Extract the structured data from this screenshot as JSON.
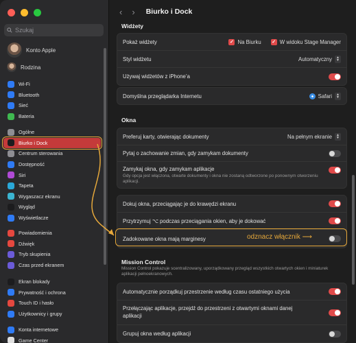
{
  "window": {
    "title": "Biurko i Dock"
  },
  "sidebar": {
    "search_placeholder": "Szukaj",
    "account_name": "Konto Apple",
    "family_label": "Rodzina",
    "groups": [
      [
        {
          "label": "Wi-Fi",
          "icon": "wifi-icon",
          "color": "#2f7bf5"
        },
        {
          "label": "Bluetooth",
          "icon": "bluetooth-icon",
          "color": "#2f7bf5"
        },
        {
          "label": "Sieć",
          "icon": "globe-icon",
          "color": "#2f7bf5"
        },
        {
          "label": "Bateria",
          "icon": "battery-icon",
          "color": "#3fb950"
        }
      ],
      [
        {
          "label": "Ogólne",
          "icon": "gear-icon",
          "color": "#8e8e93"
        },
        {
          "label": "Biurko i Dock",
          "icon": "dock-icon",
          "color": "#1c1c1e",
          "selected": true
        },
        {
          "label": "Centrum sterowania",
          "icon": "control-center-icon",
          "color": "#8e8e93"
        },
        {
          "label": "Dostępność",
          "icon": "accessibility-icon",
          "color": "#2f7bf5"
        },
        {
          "label": "Siri",
          "icon": "siri-icon",
          "color": "#b04ad6"
        },
        {
          "label": "Tapeta",
          "icon": "wallpaper-icon",
          "color": "#2aa8d8"
        },
        {
          "label": "Wygaszacz ekranu",
          "icon": "screensaver-icon",
          "color": "#3bb4d0"
        },
        {
          "label": "Wygląd",
          "icon": "appearance-icon",
          "color": "#1c1c1e"
        },
        {
          "label": "Wyświetlacze",
          "icon": "display-icon",
          "color": "#2f7bf5"
        }
      ],
      [
        {
          "label": "Powiadomienia",
          "icon": "notifications-icon",
          "color": "#e5483f"
        },
        {
          "label": "Dźwięk",
          "icon": "sound-icon",
          "color": "#e5483f"
        },
        {
          "label": "Tryb skupienia",
          "icon": "focus-icon",
          "color": "#6b5bd8"
        },
        {
          "label": "Czas przed ekranem",
          "icon": "screentime-icon",
          "color": "#6b5bd8"
        }
      ],
      [
        {
          "label": "Ekran blokady",
          "icon": "lock-screen-icon",
          "color": "#1c1c1e"
        },
        {
          "label": "Prywatność i ochrona",
          "icon": "privacy-hand-icon",
          "color": "#2f7bf5"
        },
        {
          "label": "Touch ID i hasło",
          "icon": "fingerprint-icon",
          "color": "#e5483f"
        },
        {
          "label": "Użytkownicy i grupy",
          "icon": "users-icon",
          "color": "#2f7bf5"
        }
      ],
      [
        {
          "label": "Konta internetowe",
          "icon": "at-icon",
          "color": "#2f7bf5"
        },
        {
          "label": "Game Center",
          "icon": "game-center-icon",
          "color": "#e0e0e0"
        }
      ]
    ]
  },
  "main": {
    "widgets": {
      "heading": "Widżety",
      "show_label": "Pokaż widżety",
      "opt_desktop": "Na Biurku",
      "opt_stage": "W widoku Stage Manager",
      "style_label": "Styl widżetu",
      "style_value": "Automatyczny",
      "iphone_label": "Używaj widżetów z iPhone’a"
    },
    "browser": {
      "label": "Domyślna przeglądarka Internetu",
      "value": "Safari"
    },
    "windows": {
      "heading": "Okna",
      "prefer_tabs_label": "Preferuj karty, otwierając dokumenty",
      "prefer_tabs_value": "Na pełnym ekranie",
      "ask_keep_label": "Pytaj o zachowanie zmian, gdy zamykam dokumenty",
      "close_windows_label": "Zamykaj okna, gdy zamykam aplikacje",
      "close_windows_sub": "Gdy opcja jest włączona, otwarte dokumenty i okna nie zostaną odtworzone po ponownym otworzeniu aplikacji.",
      "tile_edge_label": "Dokuj okna, przeciągając je do krawędzi ekranu",
      "tile_option_label": "Przytrzymuj ⌥ podczas przeciągania okien, aby je dokować",
      "margins_label": "Zadokowane okna mają marginesy"
    },
    "mission_control": {
      "heading": "Mission Control",
      "description": "Mission Control pokazuje scentralizowany, uporządkowany przegląd wszystkich otwartych okien i miniaturek aplikacji pełnoekranowych.",
      "auto_rearrange_label": "Automatycznie porządkuj przestrzenie według czasu ostatniego użycia",
      "switch_space_label": "Przełączając aplikacje, przejdź do przestrzeni z otwartymi oknami danej aplikacji",
      "group_windows_label": "Grupuj okna według aplikacji"
    }
  },
  "annotation": {
    "text": "odznacz włącznik",
    "arrow": "⟶"
  },
  "colors": {
    "accent": "#e04a4a",
    "annotation": "#e6a83b",
    "selection": "#c43a3a"
  }
}
